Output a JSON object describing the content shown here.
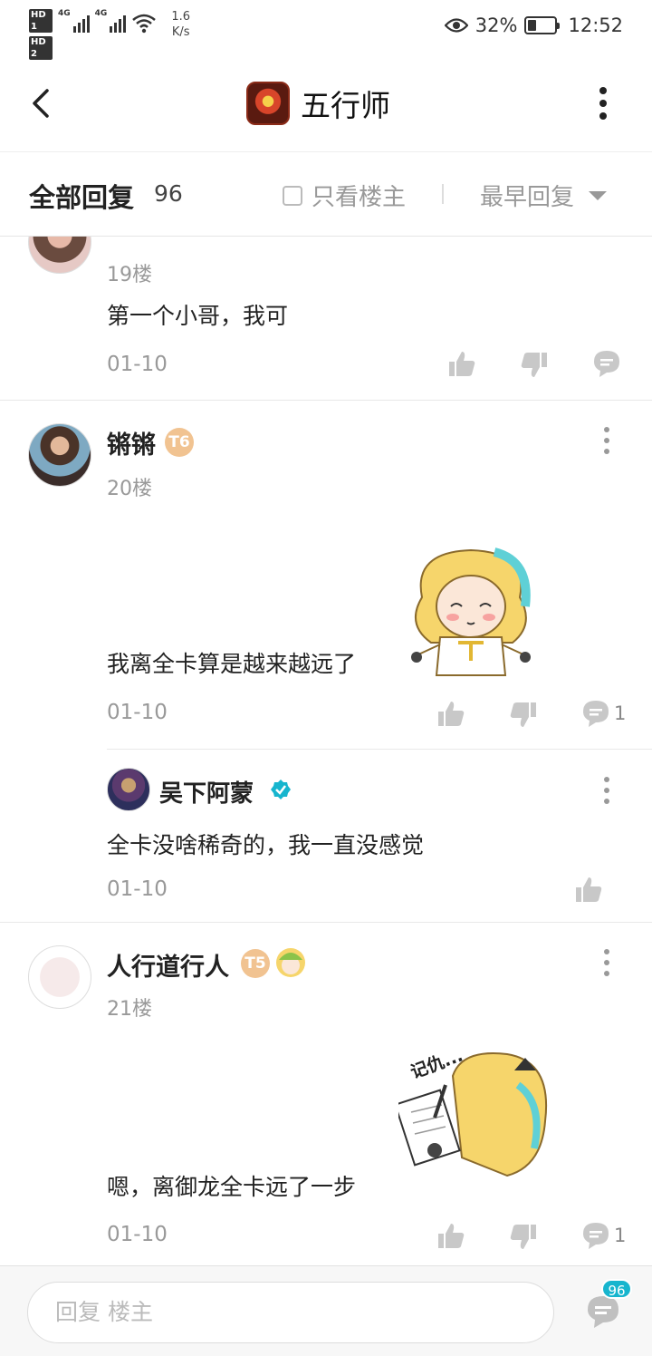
{
  "status_bar": {
    "hd1": "HD 1",
    "hd2": "HD 2",
    "net1": "4G",
    "net2": "4G",
    "speed_value": "1.6",
    "speed_unit": "K/s",
    "battery": "32%",
    "battery_level": 0.32,
    "time": "12:52"
  },
  "header": {
    "title": "五行师",
    "app_icon": "app-logo-icon"
  },
  "filter": {
    "all_replies_label": "全部回复",
    "reply_count": "96",
    "only_owner_label": "只看楼主",
    "sort_label": "最早回复"
  },
  "posts": [
    {
      "floor": "19楼",
      "body": "第一个小哥，我可",
      "date": "01-10"
    },
    {
      "name": "锵锵",
      "level_badge": "T6",
      "floor": "20楼",
      "body": "我离全卡算是越来越远了",
      "date": "01-10",
      "comment_count": "1",
      "reply": {
        "name": "吴下阿蒙",
        "body": "全卡没啥稀奇的，我一直没感觉",
        "date": "01-10"
      }
    },
    {
      "name": "人行道行人",
      "level_badge": "T5",
      "floor": "21楼",
      "body": "嗯，离御龙全卡远了一步",
      "date": "01-10",
      "comment_count": "1",
      "sticker_text": "记仇..."
    }
  ],
  "bottom_bar": {
    "reply_placeholder": "回复  楼主",
    "comment_badge": "96"
  },
  "colors": {
    "accent": "#17b5ce",
    "badge_gold": "#f1c391",
    "muted": "#999999"
  }
}
